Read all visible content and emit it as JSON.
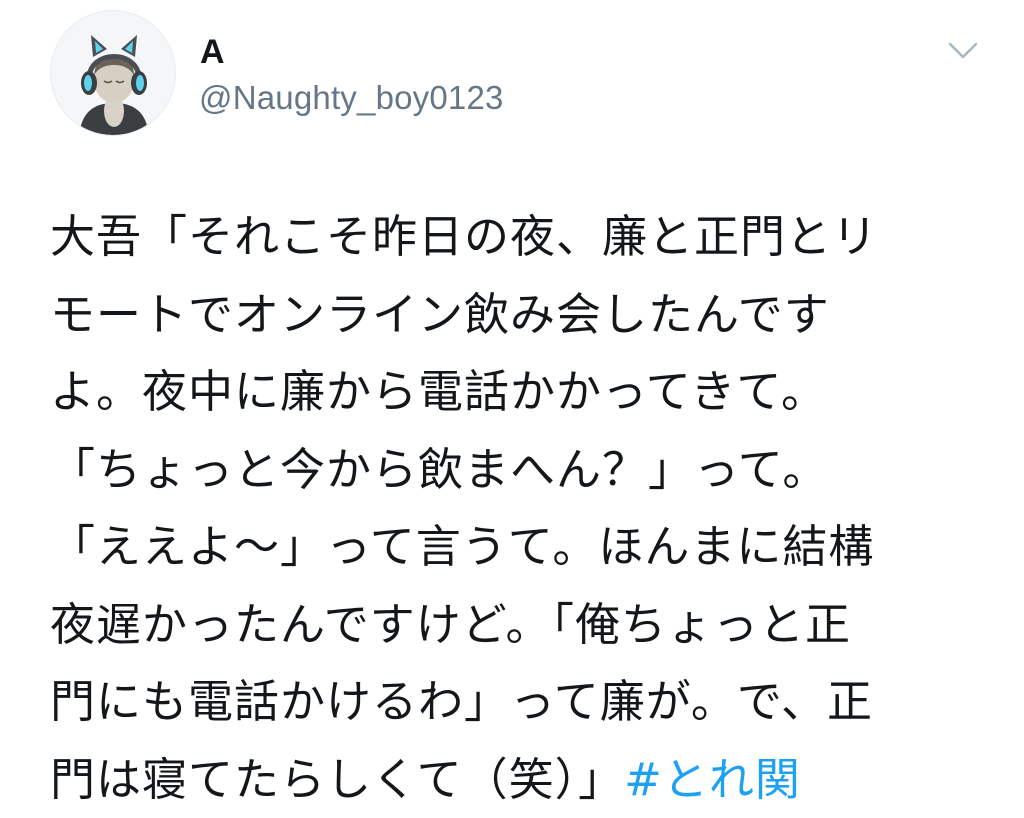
{
  "user": {
    "display_name": "A",
    "handle": "@Naughty_boy0123",
    "avatar_icon": "boy-with-cat-ear-headphones-avatar"
  },
  "menu": {
    "icon": "chevron-down-icon"
  },
  "tweet": {
    "lines": [
      "大吾「それこそ昨日の夜、廉と正門とリ",
      "モートでオンライン飲み会したんです",
      "よ。夜中に廉から電話かかってきて。",
      "「ちょっと今から飲まへん？」って。",
      "「ええよ〜」って言うて。ほんまに結構",
      "夜遅かったんですけど。「俺ちょっと正",
      "門にも電話かけるわ」って廉が。で、正"
    ],
    "last_line_text": "門は寝てたらしくて（笑）」",
    "hashtag": "#とれ関"
  },
  "colors": {
    "text": "#14171a",
    "secondary": "#657786",
    "link": "#1da1f2",
    "chevron": "#aab8c2"
  }
}
